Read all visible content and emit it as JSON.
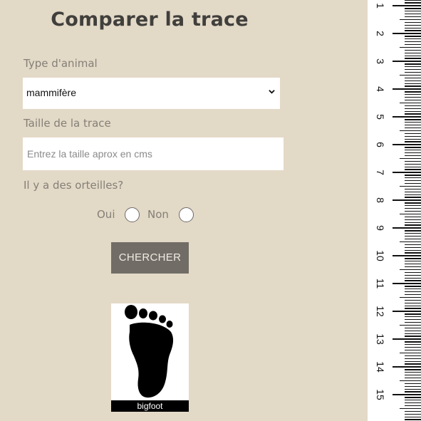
{
  "page": {
    "title": "Comparer la trace"
  },
  "form": {
    "animal_type_label": "Type d'animal",
    "animal_type_value": "mammifère",
    "size_label": "Taille de la trace",
    "size_placeholder": "Entrez la taille aprox en cms",
    "size_value": "",
    "toes_label": "Il y a des orteilles?",
    "toes_options": [
      {
        "label": "Oui",
        "checked": false
      },
      {
        "label": "Non",
        "checked": false
      }
    ],
    "search_button": "CHERCHER"
  },
  "result": {
    "image_icon": "footprint-icon",
    "caption": "bigfoot"
  },
  "ruler": {
    "unit": "cm",
    "numbers": [
      "1",
      "2",
      "3",
      "4",
      "5",
      "6",
      "7",
      "8",
      "9",
      "10",
      "11",
      "12",
      "13",
      "14",
      "15"
    ]
  },
  "colors": {
    "background": "#e3d9c7",
    "button": "#716d66",
    "title": "#403f3c",
    "label": "#847f77"
  }
}
